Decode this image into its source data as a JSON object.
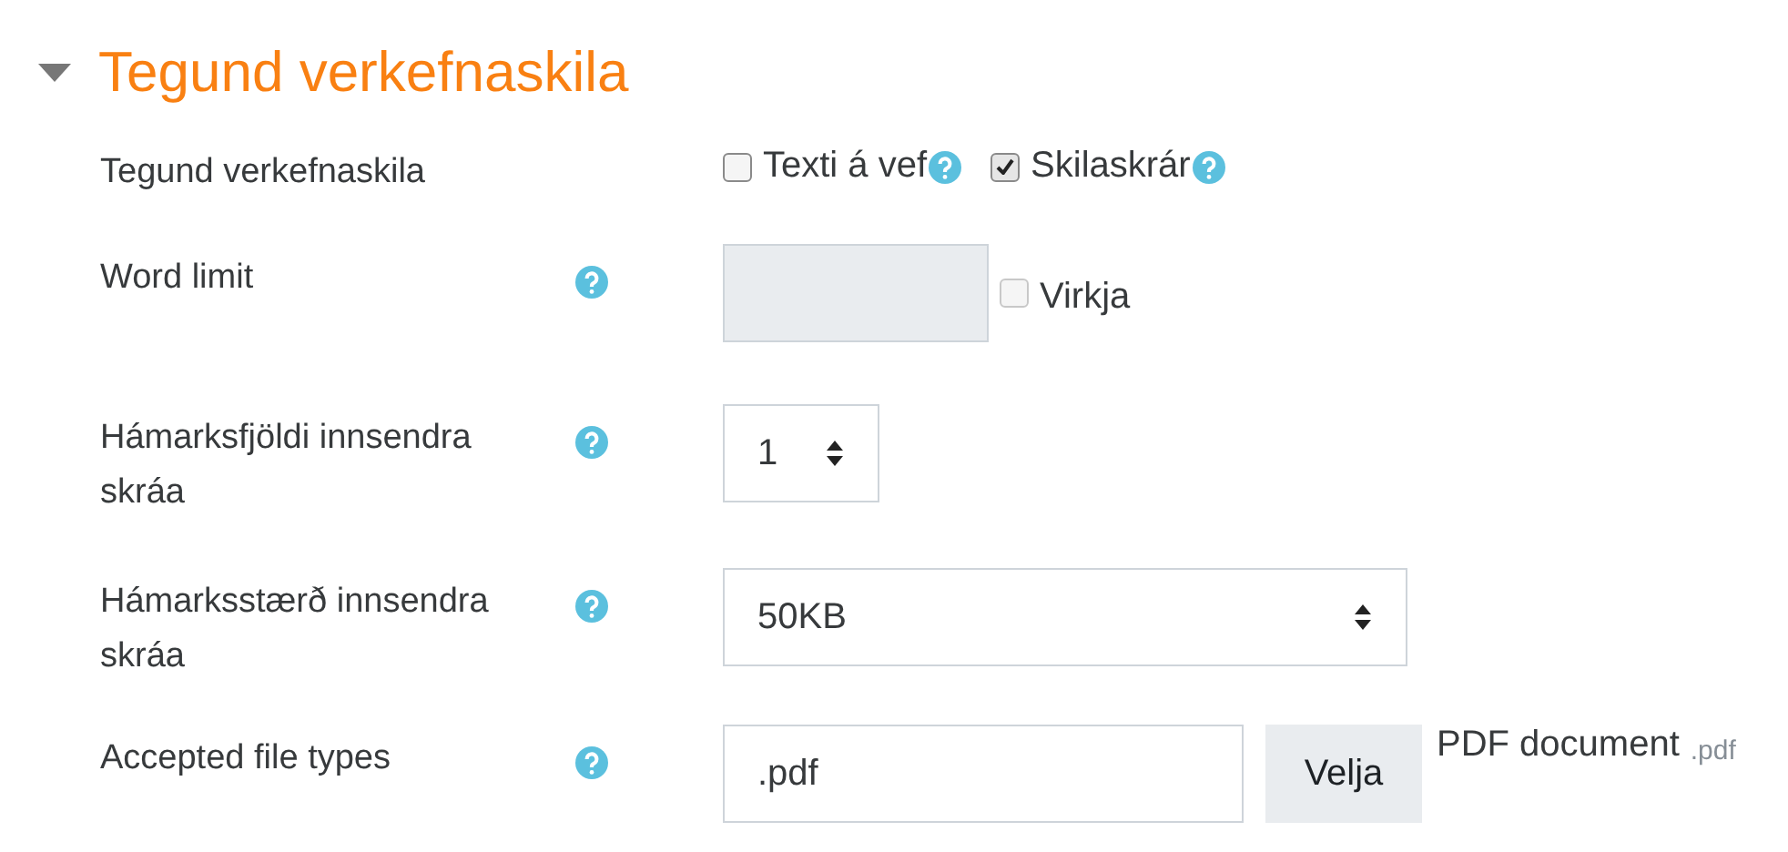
{
  "section": {
    "title": "Tegund verkefnaskila",
    "expanded": true
  },
  "fields": [
    {
      "kind": "checkboxes",
      "label": "Tegund verkefnaskila",
      "help": false,
      "options": [
        {
          "label": "Texti á vef",
          "checked": false,
          "help": true
        },
        {
          "label": "Skilaskrár",
          "checked": true,
          "help": true
        }
      ]
    },
    {
      "kind": "limit",
      "label": "Word limit",
      "help": true,
      "enable": {
        "label": "Virkja",
        "checked": false
      }
    },
    {
      "kind": "select",
      "label": "Hámarksfjöldi innsendra skráa",
      "help": true,
      "value": "1",
      "wide": false
    },
    {
      "kind": "select",
      "label": "Hámarksstærð innsendra skráa",
      "help": true,
      "value": "50KB",
      "wide": true
    },
    {
      "kind": "filetypes",
      "label": "Accepted file types",
      "help": true,
      "value": ".pdf",
      "button": "Velja",
      "type_name": "PDF document",
      "extension": ".pdf"
    }
  ]
}
